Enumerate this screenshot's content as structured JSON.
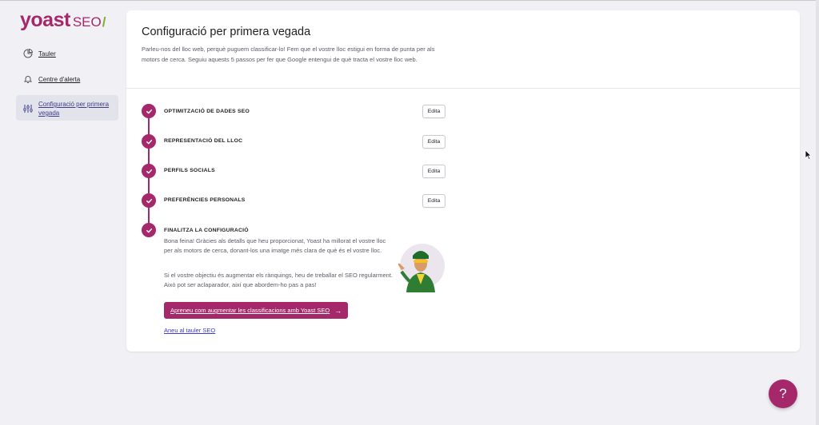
{
  "logo": {
    "yoast": "yoast",
    "seo": "SEO",
    "slash": "/"
  },
  "sidebar": {
    "items": [
      {
        "label": "Tauler",
        "icon": "pie-chart-icon"
      },
      {
        "label": "Centre d'alerta",
        "icon": "bell-icon"
      },
      {
        "label_line1": "Configuració per primera",
        "label_line2": "vegada",
        "icon": "sliders-icon",
        "active": true
      }
    ]
  },
  "main": {
    "title": "Configuració per primera vegada",
    "description": "Parleu-nos del lloc web, perquè puguem classificar-lo! Fem que el vostre lloc estigui en forma de punta per als motors de cerca. Seguiu aquests 5 passos per fer que Google entengui de què tracta el vostre lloc web.",
    "steps": [
      {
        "label": "OPTIMITZACIÓ DE DADES SEO",
        "edit": "Edita"
      },
      {
        "label": "REPRESENTACIÓ DEL LLOC",
        "edit": "Edita"
      },
      {
        "label": "PERFILS SOCIALS",
        "edit": "Edita"
      },
      {
        "label": "PREFERÈNCIES PERSONALS",
        "edit": "Edita"
      },
      {
        "label": "FINALITZA LA CONFIGURACIÓ"
      }
    ],
    "final": {
      "paragraph1": "Bona feina! Gràcies als detalls que heu proporcionat, Yoast ha millorat el vostre lloc per als motors de cerca, donant-los una imatge més clara de què és el vostre lloc.",
      "paragraph2": "Si el vostre objectiu és augmentar els rànquings, heu de treballar el SEO regularment. Això pot ser aclaparador, així que abordem-ho pas a pas!",
      "cta": "Apreneu com augmentar les classificacions amb Yoast SEO",
      "cta_arrow": "→",
      "dashboard_link": "Aneu al tauler SEO"
    }
  },
  "help": {
    "label": "?"
  },
  "colors": {
    "brand": "#a4286a",
    "accent_green": "#77b227",
    "link": "#3a3ad1"
  }
}
